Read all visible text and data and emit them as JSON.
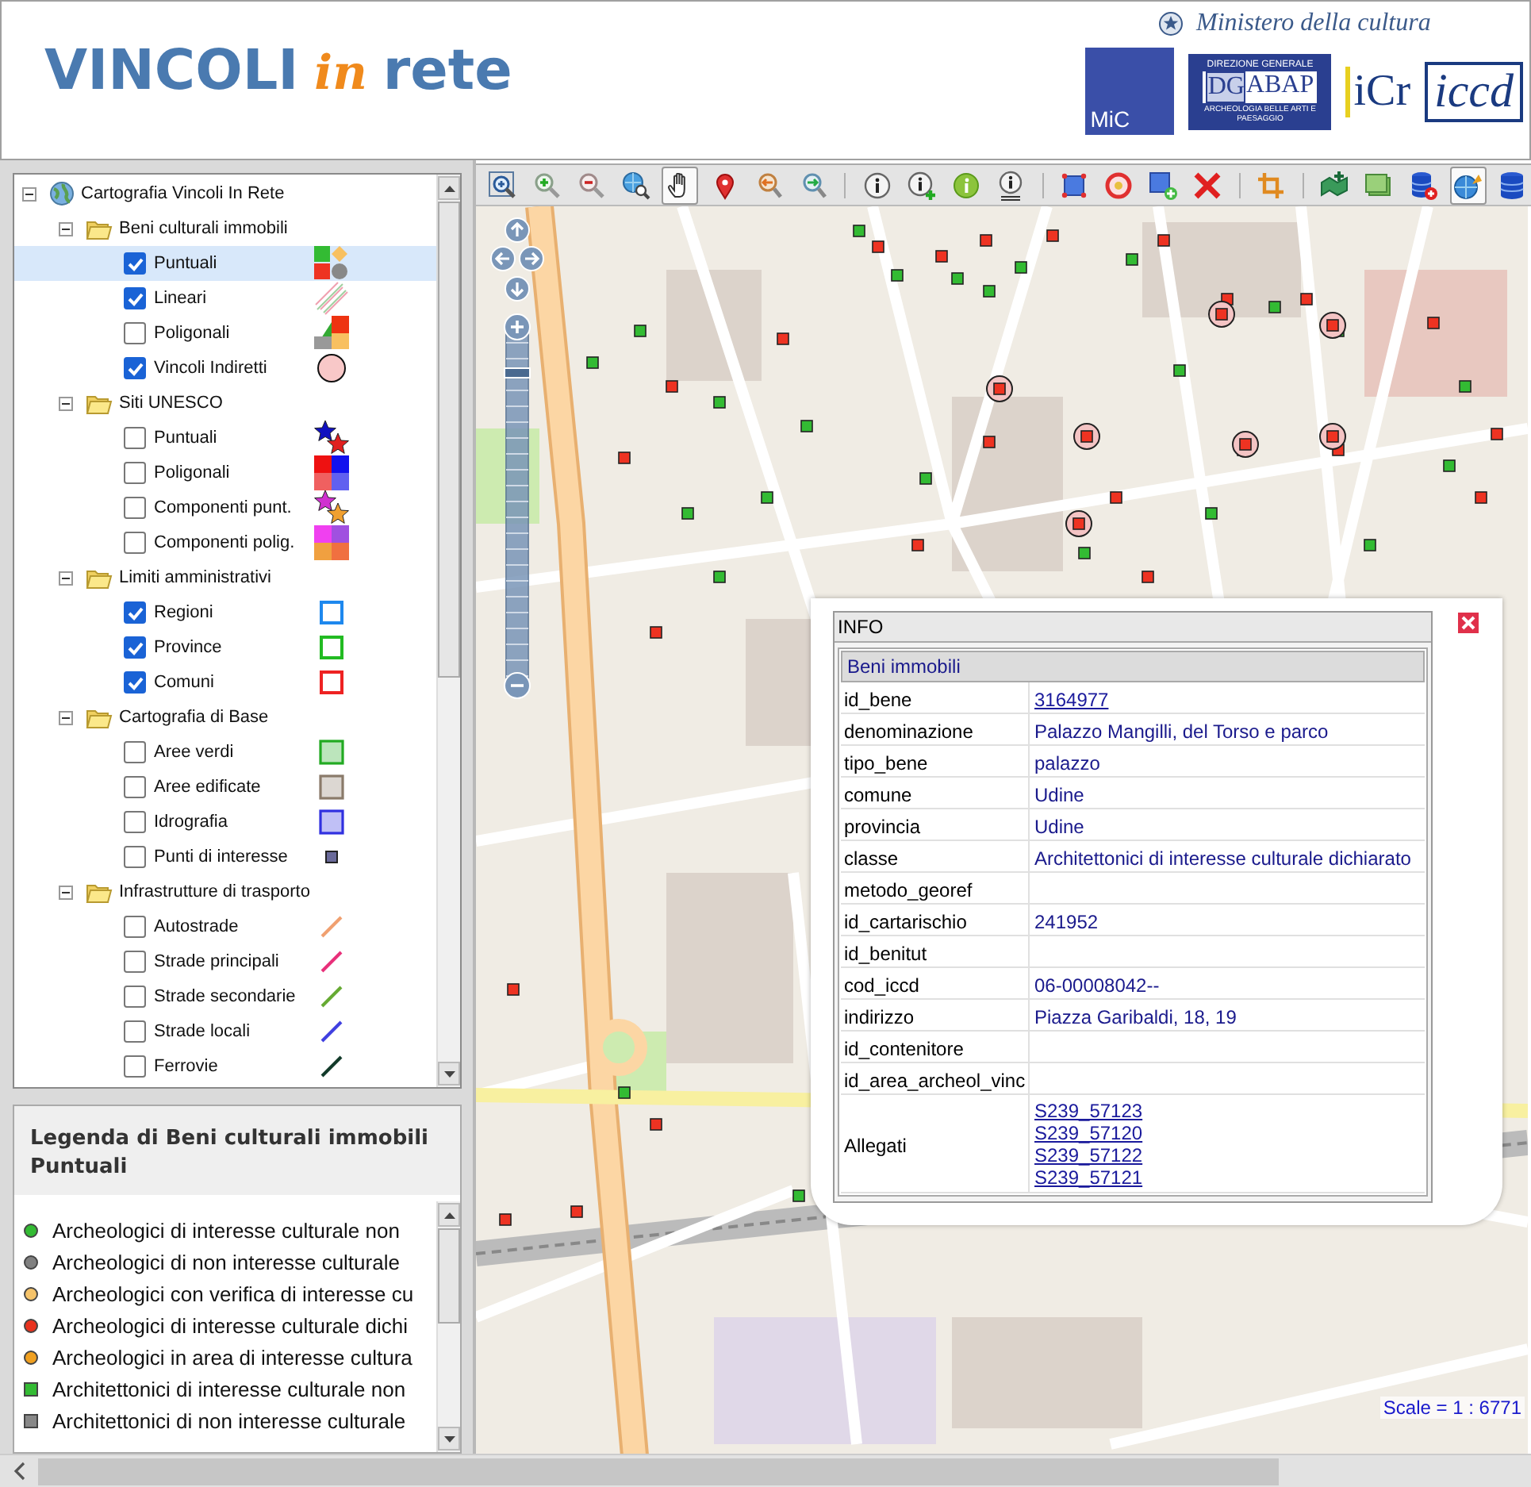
{
  "header": {
    "title_parts": [
      "VINCOLI",
      "in",
      "rete"
    ],
    "ministry": "Ministero della cultura",
    "logos": {
      "mic": "MiC",
      "dgabap_top": "DIREZIONE GENERALE",
      "dgabap_dg": "DG",
      "dgabap_abap": "ABAP",
      "dgabap_bottom": "ARCHEOLOGIA BELLE ARTI E PAESAGGIO",
      "icr": "iCr",
      "iccd": "iccd"
    }
  },
  "tree": {
    "root": {
      "label": "Cartografia Vincoli In Rete",
      "expanded": true,
      "children": [
        {
          "label": "Beni culturali immobili",
          "expanded": true,
          "children": [
            {
              "label": "Puntuali",
              "checked": true,
              "selected": true,
              "kind": "points"
            },
            {
              "label": "Lineari",
              "checked": true,
              "selected": false,
              "kind": "lines"
            },
            {
              "label": "Poligonali",
              "checked": false,
              "selected": false,
              "kind": "polygons"
            },
            {
              "label": "Vincoli Indiretti",
              "checked": true,
              "selected": false,
              "kind": "circle",
              "color": "#f8c8c8"
            }
          ]
        },
        {
          "label": "Siti UNESCO",
          "expanded": true,
          "children": [
            {
              "label": "Puntuali",
              "checked": false,
              "selected": false,
              "kind": "stars",
              "swatch": [
                {
                  "color": "#1010c0"
                },
                {
                  "color": "#e02020"
                }
              ]
            },
            {
              "label": "Poligonali",
              "checked": false,
              "selected": false,
              "kind": "grid",
              "swatch": [
                {
                  "color": "#ee1111"
                },
                {
                  "color": "#1111ee"
                },
                {
                  "color": "#f06060"
                },
                {
                  "color": "#6060f0"
                }
              ]
            },
            {
              "label": "Componenti punt.",
              "checked": false,
              "selected": false,
              "kind": "stars",
              "swatch": [
                {
                  "color": "#d030d0"
                },
                {
                  "color": "#f0a030"
                }
              ]
            },
            {
              "label": "Componenti polig.",
              "checked": false,
              "selected": false,
              "kind": "grid",
              "swatch": [
                {
                  "color": "#f040f0"
                },
                {
                  "color": "#a050e0"
                },
                {
                  "color": "#f0a040"
                },
                {
                  "color": "#f07040"
                }
              ]
            }
          ]
        },
        {
          "label": "Limiti amministrativi",
          "expanded": true,
          "children": [
            {
              "label": "Regioni",
              "checked": true,
              "selected": false,
              "kind": "square-outline",
              "color": "#1e88ee"
            },
            {
              "label": "Province",
              "checked": true,
              "selected": false,
              "kind": "square-outline",
              "color": "#22bb22"
            },
            {
              "label": "Comuni",
              "checked": true,
              "selected": false,
              "kind": "square-outline",
              "color": "#ee2222"
            }
          ]
        },
        {
          "label": "Cartografia di Base",
          "expanded": true,
          "children": [
            {
              "label": "Aree verdi",
              "checked": false,
              "selected": false,
              "kind": "square-fill",
              "color": "#22aa22"
            },
            {
              "label": "Aree edificate",
              "checked": false,
              "selected": false,
              "kind": "square-fill",
              "color": "#8a7a6a"
            },
            {
              "label": "Idrografia",
              "checked": false,
              "selected": false,
              "kind": "square-fill",
              "color": "#3030e0"
            },
            {
              "label": "Punti di interesse",
              "checked": false,
              "selected": false,
              "kind": "small-square",
              "color": "#6a6a9a"
            }
          ]
        },
        {
          "label": "Infrastrutture di trasporto",
          "expanded": true,
          "children": [
            {
              "label": "Autostrade",
              "checked": false,
              "selected": false,
              "kind": "line",
              "color": "#f0a070"
            },
            {
              "label": "Strade principali",
              "checked": false,
              "selected": false,
              "kind": "line",
              "color": "#e8307a"
            },
            {
              "label": "Strade secondarie",
              "checked": false,
              "selected": false,
              "kind": "line",
              "color": "#66aa33"
            },
            {
              "label": "Strade locali",
              "checked": false,
              "selected": false,
              "kind": "line",
              "color": "#4040e0"
            },
            {
              "label": "Ferrovie",
              "checked": false,
              "selected": false,
              "kind": "line",
              "color": "#123a2a"
            }
          ]
        }
      ]
    }
  },
  "legend": {
    "title": "Legenda di Beni culturali immobili Puntuali",
    "items": [
      {
        "label": "Archeologici di interesse culturale non",
        "kind": "circle",
        "color": "#33bb33"
      },
      {
        "label": "Archeologici di non interesse culturale",
        "kind": "circle",
        "color": "#808080"
      },
      {
        "label": "Archeologici con verifica di interesse cu",
        "kind": "circle",
        "color": "#f5c36a"
      },
      {
        "label": "Archeologici di interesse culturale dichi",
        "kind": "circle",
        "color": "#e8321e"
      },
      {
        "label": "Archeologici in area di interesse cultura",
        "kind": "circle",
        "color": "#f0a020"
      },
      {
        "label": "Architettonici di interesse culturale non",
        "kind": "square",
        "color": "#33bb33"
      },
      {
        "label": "Architettonici di non interesse culturale",
        "kind": "square",
        "color": "#888888"
      }
    ]
  },
  "toolbar": {
    "groups": [
      [
        {
          "kind": "magnifier-frame",
          "selected": false
        },
        {
          "kind": "zoom-in",
          "selected": false
        },
        {
          "kind": "zoom-out",
          "selected": false
        },
        {
          "kind": "globe-magnifier",
          "selected": false
        },
        {
          "kind": "hand",
          "selected": true
        },
        {
          "kind": "pin",
          "selected": false
        },
        {
          "kind": "magnifier-back",
          "selected": false
        },
        {
          "kind": "magnifier-forward",
          "selected": false
        }
      ],
      [
        {
          "kind": "info",
          "selected": false
        },
        {
          "kind": "info-plus",
          "selected": false
        },
        {
          "kind": "info-filled",
          "selected": false
        },
        {
          "kind": "info-document",
          "selected": false
        }
      ],
      [
        {
          "kind": "square-select",
          "selected": false
        },
        {
          "kind": "circle-select",
          "selected": false
        },
        {
          "kind": "square-plus",
          "selected": false
        },
        {
          "kind": "cross",
          "selected": false
        }
      ],
      [
        {
          "kind": "crop",
          "selected": false
        }
      ],
      [
        {
          "kind": "map-plus",
          "selected": false
        },
        {
          "kind": "layers",
          "selected": false
        },
        {
          "kind": "database-plus",
          "selected": false
        },
        {
          "kind": "globe",
          "selected": true
        },
        {
          "kind": "database",
          "selected": false
        }
      ]
    ]
  },
  "info_popup": {
    "title": "INFO",
    "section": "Beni immobili",
    "rows": [
      {
        "field": "id_bene",
        "links": [
          "3164977"
        ]
      },
      {
        "field": "denominazione",
        "value": "Palazzo Mangilli, del Torso e parco"
      },
      {
        "field": "tipo_bene",
        "value": "palazzo"
      },
      {
        "field": "comune",
        "value": "Udine"
      },
      {
        "field": "provincia",
        "value": "Udine"
      },
      {
        "field": "classe",
        "value": "Architettonici di interesse culturale dichiarato"
      },
      {
        "field": "metodo_georef"
      },
      {
        "field": "id_cartarischio",
        "value": "241952"
      },
      {
        "field": "id_benitut"
      },
      {
        "field": "cod_iccd",
        "value": "06-00008042--"
      },
      {
        "field": "indirizzo",
        "value": "Piazza Garibaldi, 18, 19"
      },
      {
        "field": "id_contenitore"
      },
      {
        "field": "id_area_archeol_vinc"
      },
      {
        "field": "Allegati",
        "links": [
          "S239_57123",
          "S239_57120",
          "S239_57122",
          "S239_57121"
        ]
      }
    ]
  },
  "map": {
    "scale": "Scale = 1 : 6771"
  }
}
